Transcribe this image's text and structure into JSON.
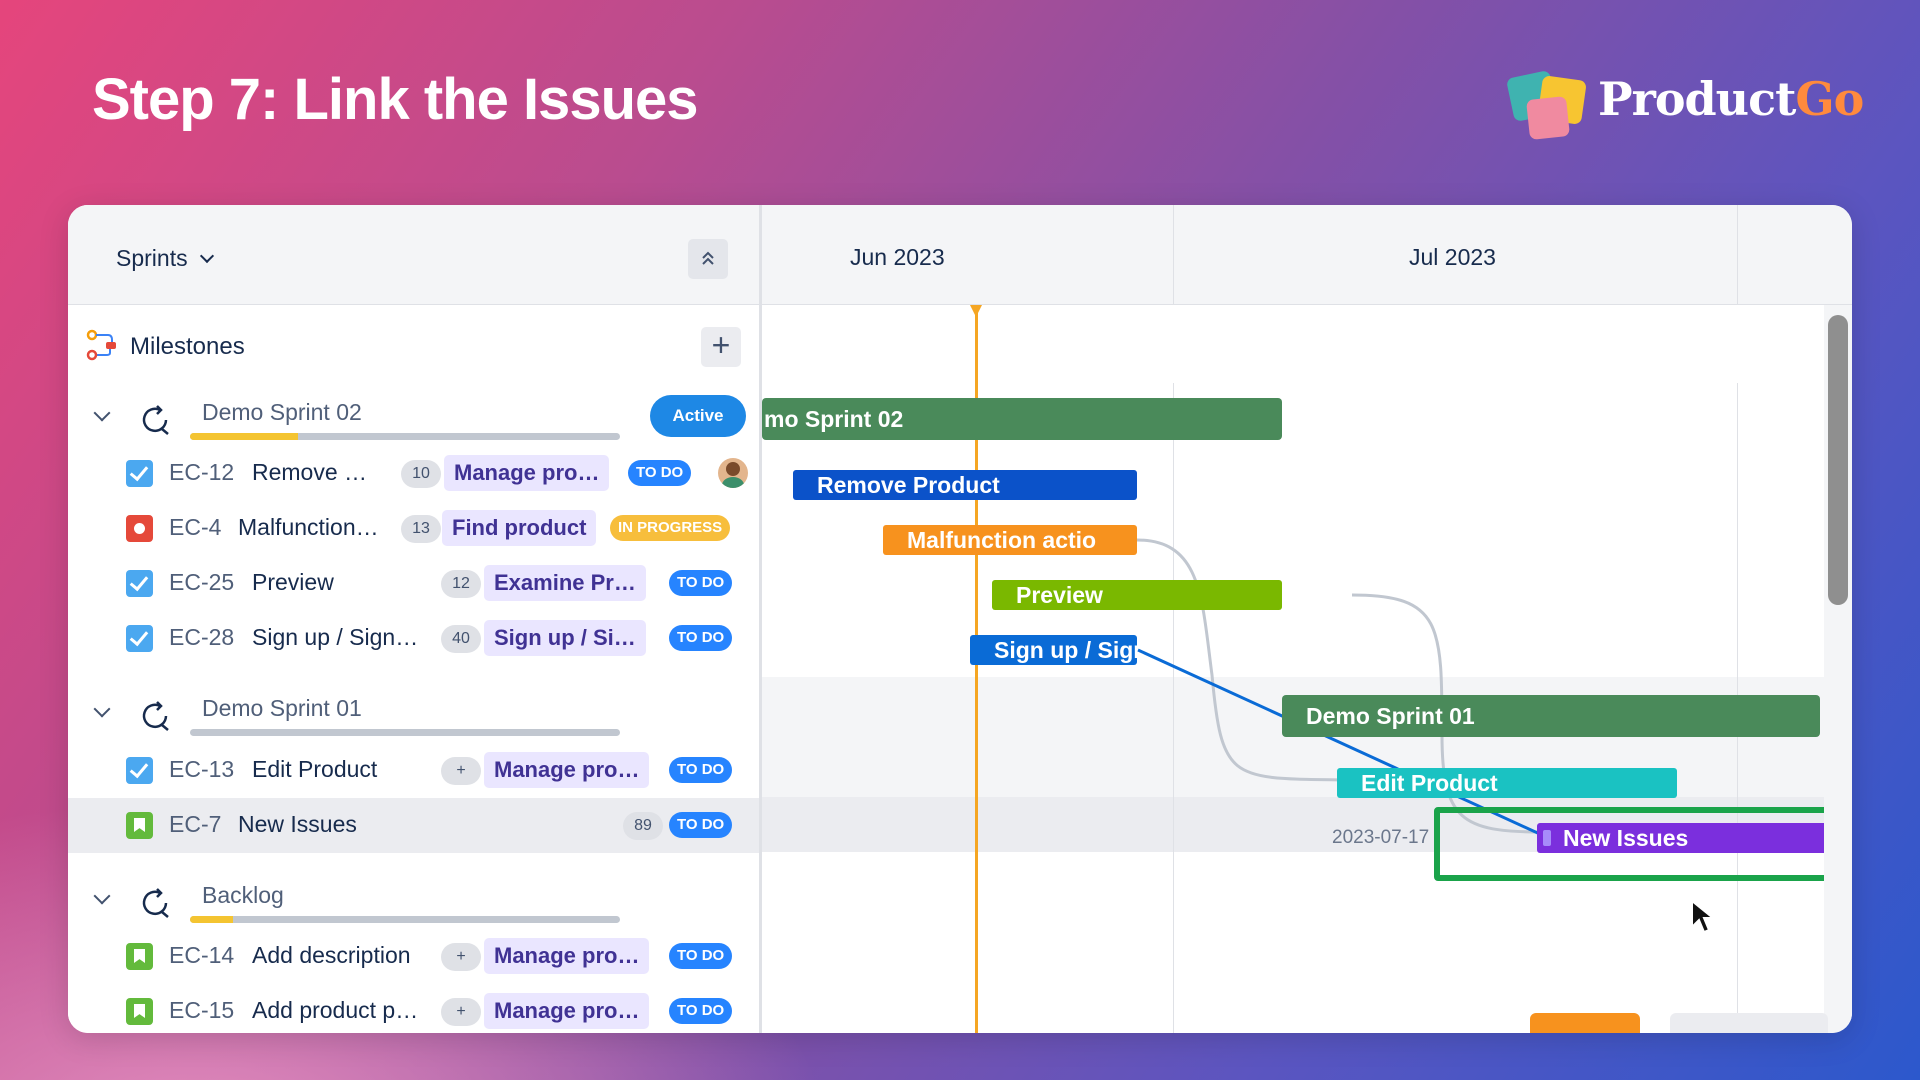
{
  "slide": {
    "title": "Step 7: Link the Issues",
    "logo": {
      "product": "Product",
      "go": "Go"
    }
  },
  "toolbar": {
    "sprints_label": "Sprints",
    "milestones_label": "Milestones",
    "add_icon": "plus-icon",
    "collapse_icon": "double-chevron-up-icon"
  },
  "timeline": {
    "months": [
      "Jun 2023",
      "Jul 2023"
    ],
    "date_marker": "2023-07-17"
  },
  "sprints": [
    {
      "name": "Demo Sprint 02",
      "badge": "Active",
      "progress": 0.25,
      "issues": [
        {
          "type": "task",
          "key": "EC-12",
          "title": "Remove …",
          "count": "10",
          "epic": "Manage pro…",
          "status": "TO DO",
          "has_avatar": true
        },
        {
          "type": "bug",
          "key": "EC-4",
          "title": "Malfunction…",
          "count": "13",
          "epic": "Find product",
          "status": "IN PROGRESS"
        },
        {
          "type": "task",
          "key": "EC-25",
          "title": "Preview",
          "count": "12",
          "epic": "Examine Pr…",
          "status": "TO DO"
        },
        {
          "type": "task",
          "key": "EC-28",
          "title": "Sign up / Sign…",
          "count": "40",
          "epic": "Sign up / Si…",
          "status": "TO DO"
        }
      ]
    },
    {
      "name": "Demo Sprint 01",
      "badge": "",
      "progress": 0,
      "issues": [
        {
          "type": "task",
          "key": "EC-13",
          "title": "Edit Product",
          "count": "+",
          "epic": "Manage pro…",
          "status": "TO DO"
        },
        {
          "type": "story",
          "key": "EC-7",
          "title": "New Issues",
          "count": "89",
          "epic": "",
          "status": "TO DO"
        }
      ]
    },
    {
      "name": "Backlog",
      "badge": "",
      "progress": 0.1,
      "issues": [
        {
          "type": "story",
          "key": "EC-14",
          "title": "Add description",
          "count": "+",
          "epic": "Manage pro…",
          "status": "TO DO"
        },
        {
          "type": "story",
          "key": "EC-15",
          "title": "Add product p…",
          "count": "+",
          "epic": "Manage pro…",
          "status": "TO DO"
        }
      ]
    }
  ],
  "gantt_bars": {
    "sprint02": "mo Sprint 02",
    "remove": "Remove Product",
    "malfunction": "Malfunction actio",
    "preview": "Preview",
    "signup": "Sign up / Sign ir",
    "sprint01": "Demo Sprint 01",
    "edit": "Edit Product",
    "new_issues": "New Issues"
  },
  "colors": {
    "sprint_bar": "#4a8a5a",
    "remove": "#0b52c9",
    "malfunction": "#f7921e",
    "preview": "#7ab800",
    "signup": "#0a6bd6",
    "edit": "#1ac2c2",
    "new_issues": "#7b2fdd",
    "highlight": "#1aa34a",
    "today": "#f5a623"
  }
}
